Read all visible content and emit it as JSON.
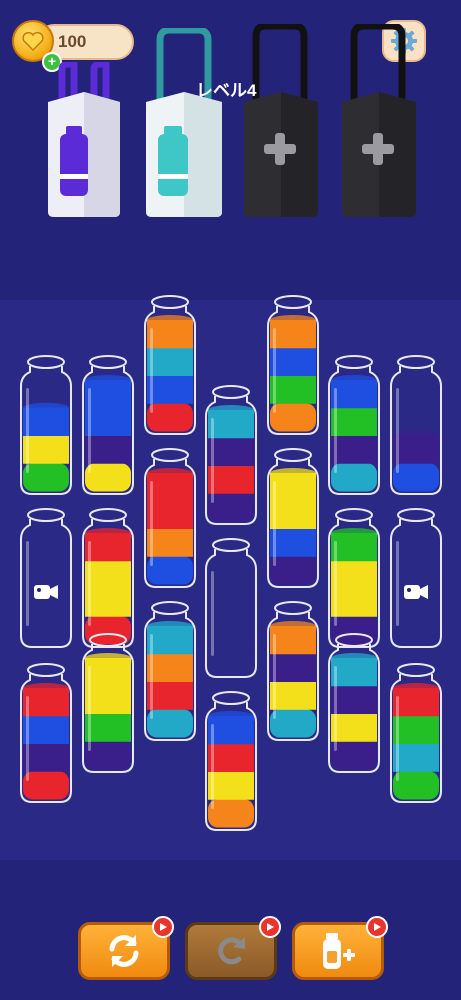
{
  "header": {
    "coins": "100",
    "level_label": "レベル4"
  },
  "icons": {
    "coin": "coin-heart-icon",
    "add": "plus-icon",
    "settings": "gear-icon",
    "video": "video-camera-icon",
    "restart": "restart-icon",
    "undo": "undo-icon",
    "add_bottle": "add-bottle-icon",
    "ad": "play-ad-icon"
  },
  "colors": {
    "background": "#23237a",
    "red": "#e8242c",
    "blue": "#1f4fe0",
    "purple": "#3a1f8a",
    "yellow": "#f4e01a",
    "green": "#22c024",
    "cyan": "#22a9c8",
    "orange": "#f5841a",
    "bag_purple": "#5a2bd6",
    "bag_cyan": "#3fc6c6"
  },
  "bags": [
    {
      "state": "collected",
      "color": "purple"
    },
    {
      "state": "collected",
      "color": "cyan"
    },
    {
      "state": "locked",
      "color": "black"
    },
    {
      "state": "locked",
      "color": "black"
    }
  ],
  "bottles": [
    {
      "id": "r1c3",
      "layers": [
        "red",
        "blue",
        "cyan",
        "orange"
      ],
      "fill": 1.0
    },
    {
      "id": "r1c5",
      "layers": [
        "orange",
        "green",
        "blue",
        "orange"
      ],
      "fill": 1.0
    },
    {
      "id": "r2c2",
      "layers": [
        "yellow",
        "purple",
        "blue",
        "blue"
      ],
      "fill": 1.0
    },
    {
      "id": "r2c6",
      "layers": [
        "cyan",
        "purple",
        "green",
        "blue"
      ],
      "fill": 1.0
    },
    {
      "id": "r2c1",
      "layers": [
        "green",
        "yellow",
        "blue"
      ],
      "fill": 0.75
    },
    {
      "id": "r2c7",
      "layers": [
        "blue",
        "purple"
      ],
      "fill": 0.5
    },
    {
      "id": "r3c4",
      "layers": [
        "purple",
        "red",
        "purple",
        "cyan"
      ],
      "fill": 1.0
    },
    {
      "id": "r4c3",
      "layers": [
        "blue",
        "orange",
        "red",
        "red"
      ],
      "fill": 1.0
    },
    {
      "id": "r4c5",
      "layers": [
        "purple",
        "blue",
        "yellow",
        "yellow"
      ],
      "fill": 1.0
    },
    {
      "id": "r5c2",
      "layers": [
        "red",
        "yellow",
        "yellow",
        "red"
      ],
      "fill": 1.0
    },
    {
      "id": "r5c6",
      "layers": [
        "purple",
        "yellow",
        "yellow",
        "green"
      ],
      "fill": 1.0
    },
    {
      "id": "r5c1",
      "layers": [],
      "fill": 0.0,
      "locked": true
    },
    {
      "id": "r5c7",
      "layers": [],
      "fill": 0.0,
      "locked": true
    },
    {
      "id": "r6c4",
      "layers": [],
      "fill": 0.0
    },
    {
      "id": "r7c3",
      "layers": [
        "cyan",
        "red",
        "orange",
        "cyan"
      ],
      "fill": 1.0
    },
    {
      "id": "r7c5",
      "layers": [
        "cyan",
        "yellow",
        "purple",
        "orange"
      ],
      "fill": 1.0
    },
    {
      "id": "r8c2",
      "layers": [
        "purple",
        "green",
        "yellow",
        "yellow"
      ],
      "fill": 1.0
    },
    {
      "id": "r8c6",
      "layers": [
        "purple",
        "yellow",
        "purple",
        "cyan"
      ],
      "fill": 1.0
    },
    {
      "id": "r9c1",
      "layers": [
        "red",
        "purple",
        "blue",
        "red"
      ],
      "fill": 1.0
    },
    {
      "id": "r9c7",
      "layers": [
        "green",
        "cyan",
        "green",
        "red"
      ],
      "fill": 1.0
    },
    {
      "id": "r10c4",
      "layers": [
        "orange",
        "yellow",
        "red",
        "blue"
      ],
      "fill": 1.0
    }
  ],
  "bottom_bar": {
    "restart": {
      "style": "orange",
      "ad": true
    },
    "undo": {
      "style": "disabled",
      "ad": true
    },
    "add_bottle": {
      "style": "orange",
      "ad": true
    }
  }
}
